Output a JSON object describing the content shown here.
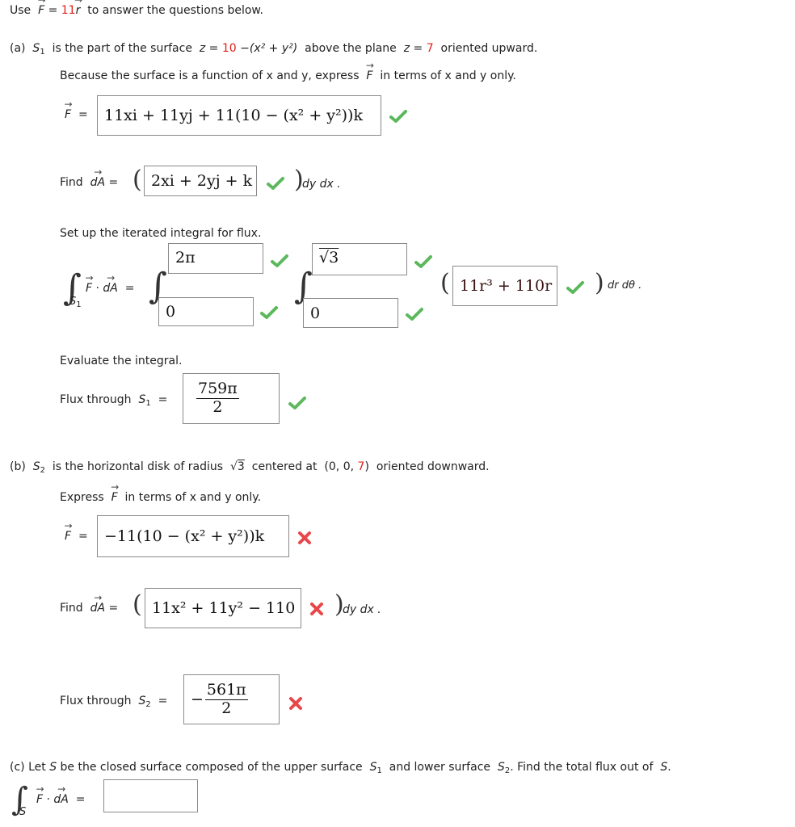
{
  "intro": {
    "prefix": "Use",
    "F": "F",
    "eq": "=",
    "coef": "11",
    "r": "r",
    "suffix": "to answer the questions below."
  },
  "part_a": {
    "label": "(a)",
    "S": "S",
    "sub": "1",
    "t1": "is the part of the surface",
    "z": "z",
    "eq": "=",
    "ten": "10",
    "expr": "−(x² + y²)",
    "t2": "above the plane",
    "seven": "7",
    "t3": "oriented upward.",
    "instr1": "Because the surface is a function of x and y, express",
    "instr1b": "in terms of x and y only.",
    "F_answer": "11xi + 11yj + 11(10 − (x² + y²))k",
    "F_status": "correct",
    "find_label": "Find",
    "dA": "dA",
    "dA_answer": "2xi + 2yj + k",
    "dA_status": "correct",
    "dydx": "dy dx .",
    "setup": "Set up the iterated integral for flux.",
    "outer_upper": "2π",
    "outer_upper_status": "correct",
    "outer_lower": "0",
    "outer_lower_status": "correct",
    "inner_upper": "√3",
    "inner_upper_status": "correct",
    "inner_lower": "0",
    "inner_lower_status": "correct",
    "integrand": "11r³ + 110r",
    "integrand_status": "correct",
    "drdtheta": "dr dθ .",
    "evaluate": "Evaluate the integral.",
    "flux_label": "Flux through",
    "flux_num": "759π",
    "flux_den": "2",
    "flux_status": "correct"
  },
  "part_b": {
    "label": "(b)",
    "S": "S",
    "sub": "2",
    "t1": "is the horizontal disk of radius",
    "radius": "3",
    "t2": "centered at",
    "center_pre": "(0, 0,",
    "center_z": "7",
    "center_post": ")",
    "t3": "oriented downward.",
    "instr": "Express",
    "instr_b": "in terms of x and y only.",
    "F_answer": "−11(10 − (x² + y²))k",
    "F_status": "incorrect",
    "find_label": "Find",
    "dA_answer": "11x² + 11y² − 110",
    "dA_status": "incorrect",
    "dydx": "dy dx .",
    "flux_label": "Flux through",
    "flux_sign": "−",
    "flux_num": "561π",
    "flux_den": "2",
    "flux_status": "incorrect"
  },
  "part_c": {
    "label": "(c)",
    "text1": "Let",
    "S": "S",
    "text2": "be the closed surface composed of the upper surface",
    "S1": "S",
    "sub1": "1",
    "text3": "and lower surface",
    "S2": "S",
    "sub2": "2",
    "text4": ". Find the total flux out of",
    "text5": ".",
    "answer": ""
  },
  "colors": {
    "correct": "#5cb85c",
    "incorrect": "#e8474a",
    "highlight": "#e0201a"
  }
}
